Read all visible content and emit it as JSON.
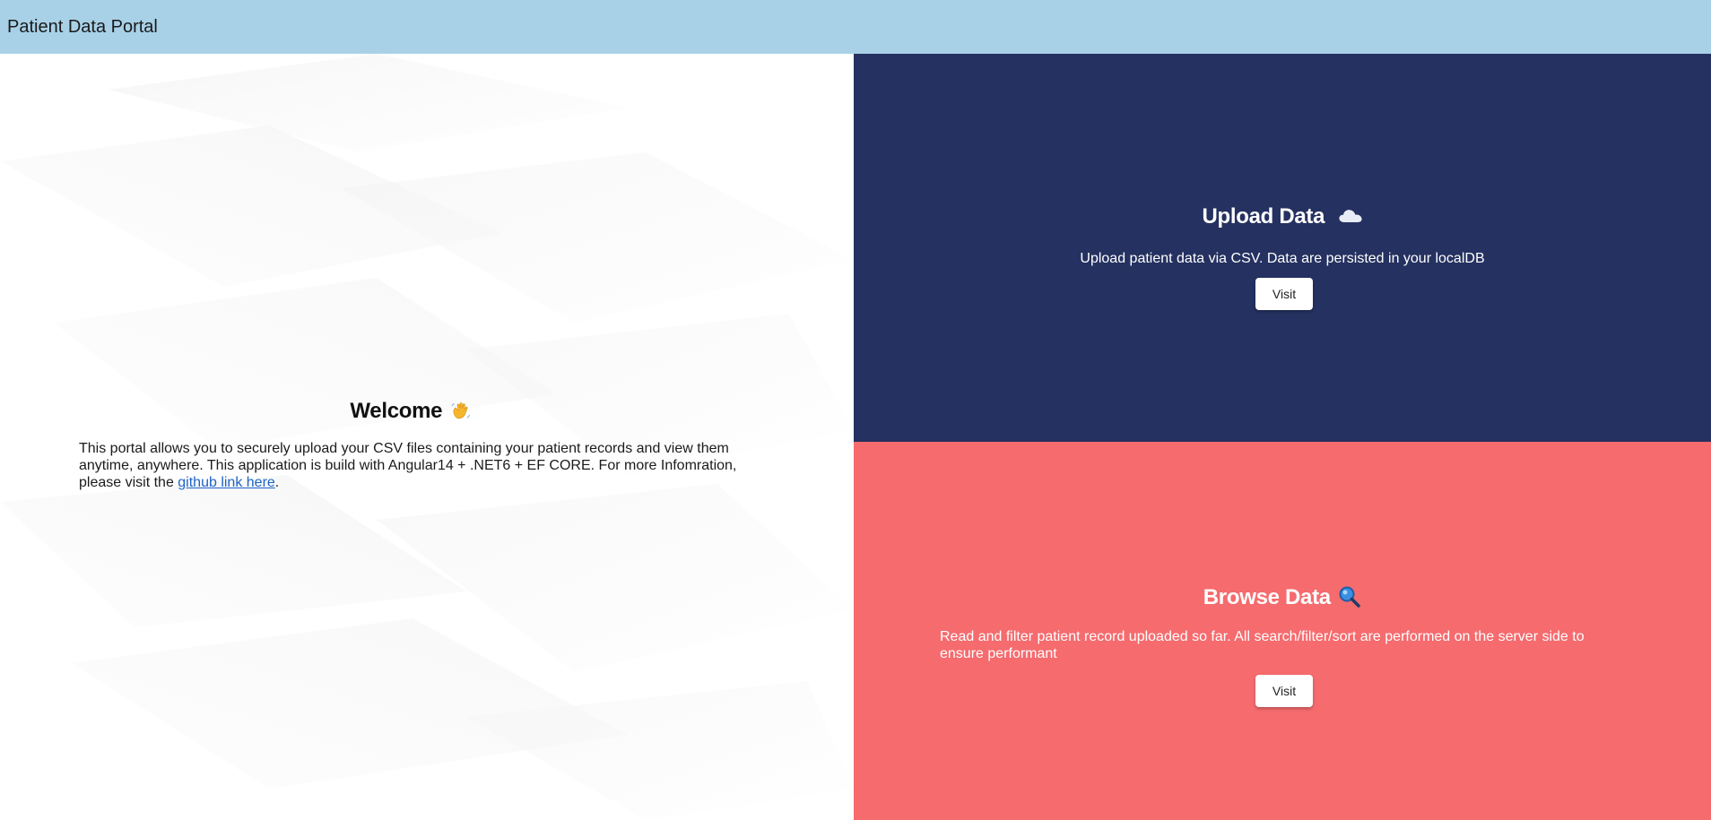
{
  "toolbar": {
    "title": "Patient Data Portal"
  },
  "welcome": {
    "title": "Welcome",
    "title_icon": "waving-hand-icon",
    "text_before_link": "This portal allows you to securely upload your CSV files containing your patient records and view them anytime, anywhere. This application is build with Angular14 + .NET6 + EF CORE. For more Infomration, please visit the ",
    "link_text": "github link here",
    "text_after_link": "."
  },
  "upload": {
    "title": "Upload Data",
    "title_icon": "cloud-icon",
    "description": "Upload patient data via CSV. Data are persisted in your localDB",
    "button_label": "Visit",
    "background_color": "#253160"
  },
  "browse": {
    "title": "Browse Data",
    "title_icon": "magnifying-glass-icon",
    "description": "Read and filter patient record uploaded so far. All search/filter/sort are performed on the server side to ensure performant",
    "button_label": "Visit",
    "background_color": "#f56b6e"
  },
  "colors": {
    "toolbar": "#a8d1e7",
    "link": "#1e63c6"
  }
}
